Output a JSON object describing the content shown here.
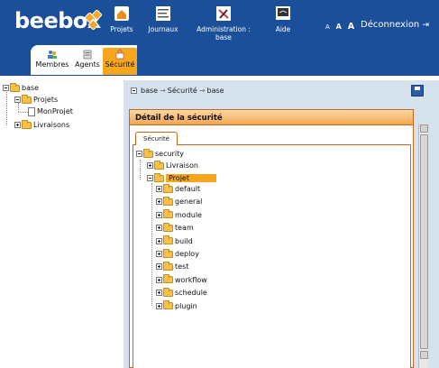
{
  "header": {
    "logo": "beebox",
    "nav": [
      {
        "label": "Projets",
        "icon": "home-icon"
      },
      {
        "label": "Journaux",
        "icon": "journal-icon"
      },
      {
        "label": "Administration : base",
        "icon": "admin-icon"
      },
      {
        "label": "Aide",
        "icon": "help-icon"
      }
    ],
    "font_sizes": [
      "A",
      "A",
      "A"
    ],
    "logout_label": "Déconnexion"
  },
  "tabs": [
    {
      "label": "Membres",
      "icon": "members-icon"
    },
    {
      "label": "Agents",
      "icon": "agents-icon"
    },
    {
      "label": "Sécurité",
      "icon": "security-icon",
      "active": true
    }
  ],
  "left_tree": {
    "root": "base",
    "projets": "Projets",
    "monprojet": "MonProjet",
    "livraisons": "Livraisons"
  },
  "breadcrumb": {
    "items": [
      "base",
      "Sécurité",
      "base"
    ],
    "separator": "→"
  },
  "panel": {
    "title": "Détail de la sécurité",
    "tab": "Sécurité",
    "tree": {
      "root": "security",
      "livraison": "Livraison",
      "projet": "Projet",
      "children": [
        "default",
        "general",
        "module",
        "team",
        "build",
        "deploy",
        "test",
        "workflow",
        "schedule",
        "plugin"
      ]
    }
  },
  "colors": {
    "header": "#1c4f9a",
    "accent": "#f7a61d",
    "panel_border": "#c7641e"
  }
}
